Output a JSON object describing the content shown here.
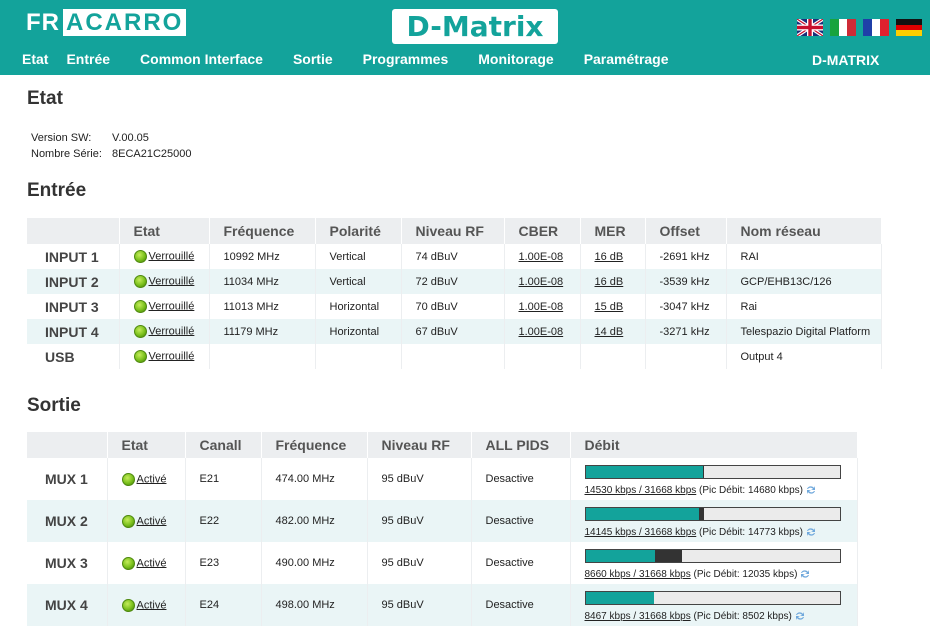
{
  "header": {
    "logo_prefix": "FR",
    "logo_boxed": "ACARRO",
    "product": "D-Matrix",
    "brand": "D-MATRIX",
    "flags": [
      "uk-flag",
      "italy-flag",
      "france-flag",
      "germany-flag"
    ]
  },
  "nav": [
    "Etat",
    "Entrée",
    "Common Interface",
    "Sortie",
    "Programmes",
    "Monitorage",
    "Paramétrage"
  ],
  "etat": {
    "title": "Etat",
    "version_label": "Version SW:",
    "version_value": "V.00.05",
    "serial_label": "Nombre Série:",
    "serial_value": "8ECA21C25000"
  },
  "entree": {
    "title": "Entrée",
    "headers": [
      "",
      "Etat",
      "Fréquence",
      "Polarité",
      "Niveau RF",
      "CBER",
      "MER",
      "Offset",
      "Nom réseau"
    ],
    "rows": [
      {
        "name": "INPUT 1",
        "etat": "Verrouillé",
        "freq": "10992 MHz",
        "pol": "Vertical",
        "rf": "74 dBuV",
        "cber": "1.00E-08",
        "mer": "16 dB",
        "offset": "-2691 kHz",
        "net": "RAI"
      },
      {
        "name": "INPUT 2",
        "etat": "Verrouillé",
        "freq": "11034 MHz",
        "pol": "Vertical",
        "rf": "72 dBuV",
        "cber": "1.00E-08",
        "mer": "16 dB",
        "offset": "-3539 kHz",
        "net": "GCP/EHB13C/126"
      },
      {
        "name": "INPUT 3",
        "etat": "Verrouillé",
        "freq": "11013 MHz",
        "pol": "Horizontal",
        "rf": "70 dBuV",
        "cber": "1.00E-08",
        "mer": "15 dB",
        "offset": "-3047 kHz",
        "net": "Rai"
      },
      {
        "name": "INPUT 4",
        "etat": "Verrouillé",
        "freq": "11179 MHz",
        "pol": "Horizontal",
        "rf": "67 dBuV",
        "cber": "1.00E-08",
        "mer": "14 dB",
        "offset": "-3271 kHz",
        "net": "Telespazio Digital Platform"
      },
      {
        "name": "USB",
        "etat": "Verrouillé",
        "freq": "",
        "pol": "",
        "rf": "",
        "cber": "",
        "mer": "",
        "offset": "",
        "net": "Output 4"
      }
    ]
  },
  "sortie": {
    "title": "Sortie",
    "headers": [
      "",
      "Etat",
      "Canall",
      "Fréquence",
      "Niveau RF",
      "ALL PIDS",
      "Débit"
    ],
    "rows": [
      {
        "name": "MUX 1",
        "etat": "Activé",
        "canal": "E21",
        "freq": "474.00 MHz",
        "rf": "95 dBuV",
        "pids": "Desactive",
        "rate": "14530 kbps / 31668 kbps",
        "peak": "(Pic Débit: 14680 kbps)",
        "fill_ratio": 0.4588,
        "peak_ratio": 0.4636
      },
      {
        "name": "MUX 2",
        "etat": "Activé",
        "canal": "E22",
        "freq": "482.00 MHz",
        "rf": "95 dBuV",
        "pids": "Desactive",
        "rate": "14145 kbps / 31668 kbps",
        "peak": "(Pic Débit: 14773 kbps)",
        "fill_ratio": 0.4467,
        "peak_ratio": 0.4665
      },
      {
        "name": "MUX 3",
        "etat": "Activé",
        "canal": "E23",
        "freq": "490.00 MHz",
        "rf": "95 dBuV",
        "pids": "Desactive",
        "rate": "8660 kbps / 31668 kbps",
        "peak": "(Pic Débit: 12035 kbps)",
        "fill_ratio": 0.2735,
        "peak_ratio": 0.38
      },
      {
        "name": "MUX 4",
        "etat": "Activé",
        "canal": "E24",
        "freq": "498.00 MHz",
        "rf": "95 dBuV",
        "pids": "Desactive",
        "rate": "8467 kbps / 31668 kbps",
        "peak": "(Pic Débit: 8502 kbps)",
        "fill_ratio": 0.2674,
        "peak_ratio": 0.2685
      }
    ]
  },
  "colors": {
    "teal": "#13a39b",
    "row_alt": "#eaf5f6",
    "header_bg": "#eceef0"
  }
}
